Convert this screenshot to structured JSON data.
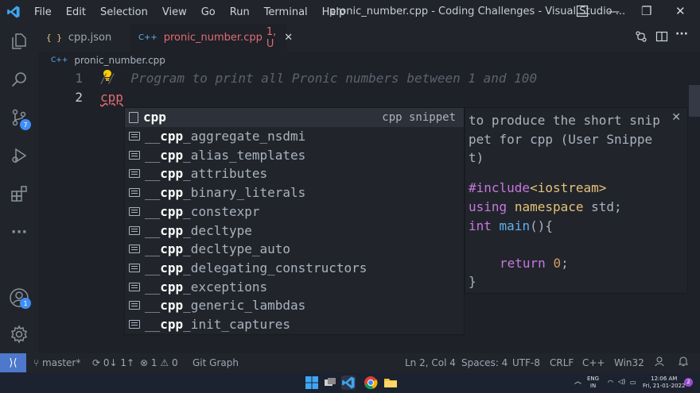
{
  "titlebar": {
    "menu": [
      "File",
      "Edit",
      "Selection",
      "View",
      "Go",
      "Run",
      "Terminal",
      "Help"
    ],
    "title": "pronic_number.cpp - Coding Challenges - Visual Studio ...",
    "minimize": "—",
    "maximize": "❐",
    "close": "✕"
  },
  "activity_bar": {
    "icons": [
      "explorer-icon",
      "search-icon",
      "source-control-icon",
      "run-debug-icon",
      "extensions-icon",
      "more-icon",
      "accounts-icon",
      "manage-gear-icon"
    ],
    "source_control_badge": "7",
    "accounts_badge": "1",
    "more_label": "···"
  },
  "tabs": [
    {
      "icon": "{ }",
      "label": "cpp.json",
      "active": false
    },
    {
      "icon": "C++",
      "label": "pronic_number.cpp",
      "status": "1, U",
      "close": "✕",
      "active": true
    }
  ],
  "breadcrumb": {
    "icon": "C++",
    "file": "pronic_number.cpp"
  },
  "editor": {
    "lines": [
      {
        "number": "1",
        "text": "//  Program to print all Pronic numbers between 1 and 100"
      },
      {
        "number": "2",
        "text": "cpp"
      }
    ]
  },
  "suggest": {
    "items": [
      {
        "prefix": "",
        "match": "cpp",
        "rest": "",
        "detail": "cpp snippet",
        "kind": "snippet"
      },
      {
        "prefix": "__",
        "match": "cpp",
        "rest": "_aggregate_nsdmi",
        "detail": "",
        "kind": "text"
      },
      {
        "prefix": "__",
        "match": "cpp",
        "rest": "_alias_templates",
        "detail": "",
        "kind": "text"
      },
      {
        "prefix": "__",
        "match": "cpp",
        "rest": "_attributes",
        "detail": "",
        "kind": "text"
      },
      {
        "prefix": "__",
        "match": "cpp",
        "rest": "_binary_literals",
        "detail": "",
        "kind": "text"
      },
      {
        "prefix": "__",
        "match": "cpp",
        "rest": "_constexpr",
        "detail": "",
        "kind": "text"
      },
      {
        "prefix": "__",
        "match": "cpp",
        "rest": "_decltype",
        "detail": "",
        "kind": "text"
      },
      {
        "prefix": "__",
        "match": "cpp",
        "rest": "_decltype_auto",
        "detail": "",
        "kind": "text"
      },
      {
        "prefix": "__",
        "match": "cpp",
        "rest": "_delegating_constructors",
        "detail": "",
        "kind": "text"
      },
      {
        "prefix": "__",
        "match": "cpp",
        "rest": "_exceptions",
        "detail": "",
        "kind": "text"
      },
      {
        "prefix": "__",
        "match": "cpp",
        "rest": "_generic_lambdas",
        "detail": "",
        "kind": "text"
      },
      {
        "prefix": "__",
        "match": "cpp",
        "rest": "_init_captures",
        "detail": "",
        "kind": "text"
      }
    ],
    "details": {
      "description": "to produce the short snippet for cpp (User Snippet)",
      "close": "✕",
      "code": {
        "include_kw": "#include",
        "include_lib": "<iostream>",
        "using_kw": "using",
        "namespace_kw": "namespace",
        "std": "std;",
        "int_kw": "int",
        "main": "main",
        "parens": "(){",
        "return_kw": "return",
        "zero": "0",
        "semicolon": ";",
        "close_brace": "}"
      }
    }
  },
  "statusbar": {
    "remote": "⟩⟨",
    "branch": "master*",
    "sync": "0↓ 1↑",
    "errors": "1",
    "warnings": "0",
    "git_graph": "Git Graph",
    "position": "Ln 2, Col 4",
    "spaces": "Spaces: 4",
    "encoding": "UTF-8",
    "eol": "CRLF",
    "language": "C++",
    "platform": "Win32"
  },
  "taskbar": {
    "lang_top": "ENG",
    "lang_bottom": "IN",
    "time": "12:06 AM",
    "date": "Fri, 21-01-2022",
    "notification_count": "2"
  },
  "colors": {
    "accent": "#4d78cc",
    "badge": "#3f8ff7",
    "error_red": "#e06c75",
    "keyword": "#c678dd",
    "function": "#61afef",
    "type": "#e5c07b",
    "number": "#d19a66"
  }
}
